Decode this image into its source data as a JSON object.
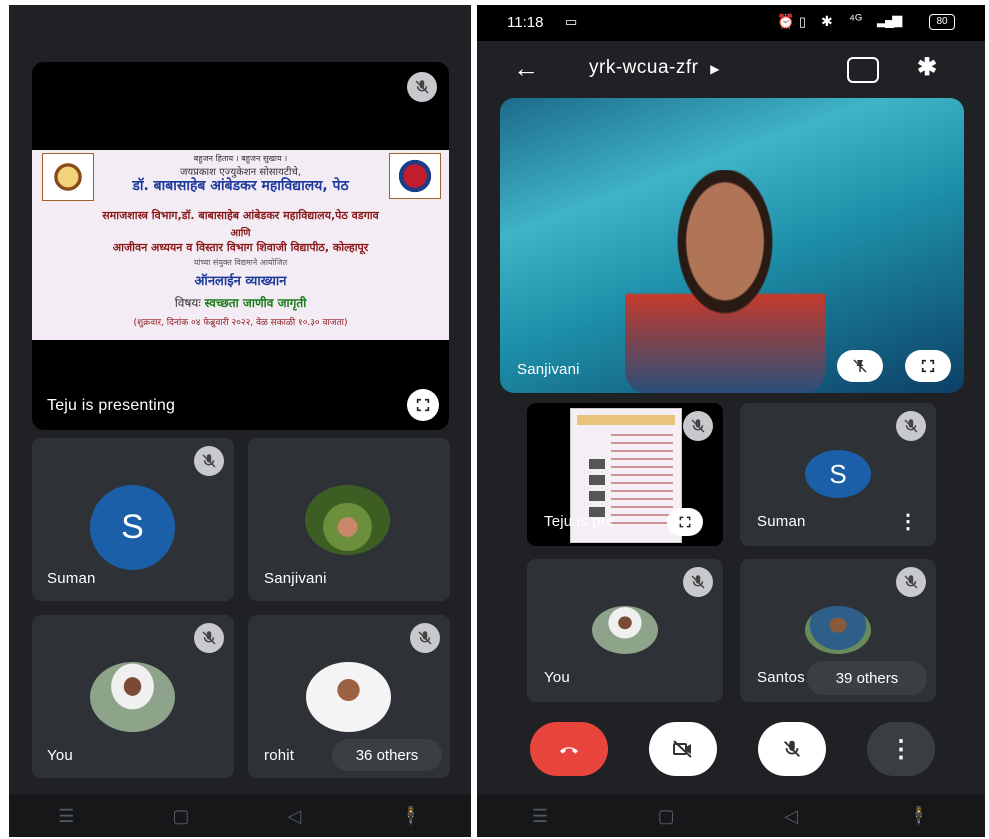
{
  "left": {
    "presentation": {
      "banner_line1": "बहुजन हिताय । बहुजन सुखाय ।",
      "banner_line2": "जयप्रकाश एज्युकेशन सोसायटीचे,",
      "banner_line3": "डॉ. बाबासाहेब आंबेडकर महाविद्यालय, पेठ",
      "banner_line4": "समाजशास्त्र विभाग,डॉ. बाबासाहेब आंबेडकर महाविद्यालय,पेठ वडगाव",
      "banner_line5": "आणि",
      "banner_line6": "आजीवन अध्ययन व विस्तार विभाग शिवाजी विद्यापीठ, कोल्हापूर",
      "banner_line7": "यांच्या संयुक्त विद्यमाने आयोजित",
      "banner_line8": "ऑनलाईन व्याख्यान",
      "banner_subject_label": "विषयः",
      "banner_subject": "स्वच्छता जाणीव जागृती",
      "banner_date": "(शुक्रवार, दिनांक ०४ फेब्रुवारी २०२२, वेळ सकाळी १०.३० वाजता)",
      "caption": "Teju is presenting"
    },
    "tiles": [
      {
        "name": "Suman",
        "avatar": "S"
      },
      {
        "name": "Sanjivani"
      },
      {
        "name": "You"
      },
      {
        "name": "rohit"
      }
    ],
    "others": "36 others"
  },
  "right": {
    "status": {
      "time": "11:18",
      "battery": "80",
      "network": "⁴ᴳ"
    },
    "meeting_code": "yrk-wcua-zfr",
    "speaker_name": "Sanjivani",
    "tiles": [
      {
        "name": "Teju is pre..."
      },
      {
        "name": "Suman",
        "avatar": "S"
      },
      {
        "name": "You"
      },
      {
        "name": "Santos"
      }
    ],
    "others": "39 others"
  },
  "colors": {
    "bg": "#1f2125",
    "tile": "#2e3136",
    "end_call": "#e8453c",
    "avatar": "#1a5fa8"
  }
}
